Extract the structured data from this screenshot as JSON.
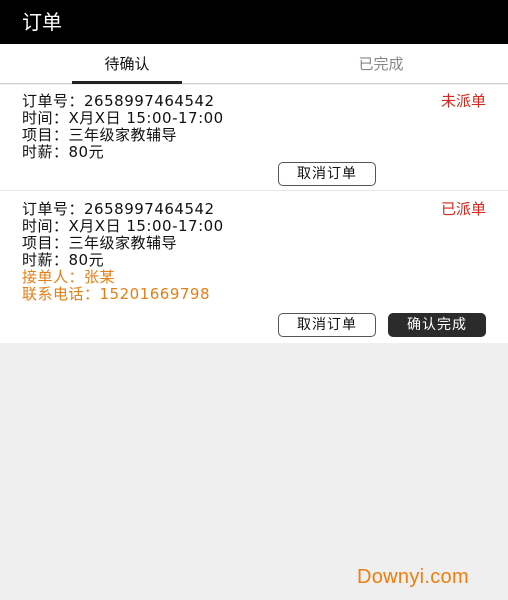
{
  "header": {
    "title": "订单"
  },
  "tabs": [
    {
      "label": "待确认",
      "active": true
    },
    {
      "label": "已完成",
      "active": false
    }
  ],
  "orders": [
    {
      "order_no_label": "订单号：",
      "order_no": "2658997464542",
      "status": "未派单",
      "time_label": "时间：",
      "time": "X月X日 15:00-17:00",
      "item_label": "项目：",
      "item": "三年级家教辅导",
      "pay_label": "时薪：",
      "pay": "80元",
      "cancel_label": "取消订单"
    },
    {
      "order_no_label": "订单号：",
      "order_no": "2658997464542",
      "status": "已派单",
      "time_label": "时间：",
      "time": "X月X日 15:00-17:00",
      "item_label": "项目：",
      "item": "三年级家教辅导",
      "pay_label": "时薪：",
      "pay": "80元",
      "taker_label": "接单人：",
      "taker": "张某",
      "phone_label": "联系电话：",
      "phone": "15201669798",
      "cancel_label": "取消订单",
      "confirm_label": "确认完成"
    }
  ],
  "colors": {
    "status_red": "#d9261c",
    "taker_orange": "#e67e14",
    "header_bg": "#000000"
  },
  "watermark": {
    "text": "Downyi.com"
  }
}
